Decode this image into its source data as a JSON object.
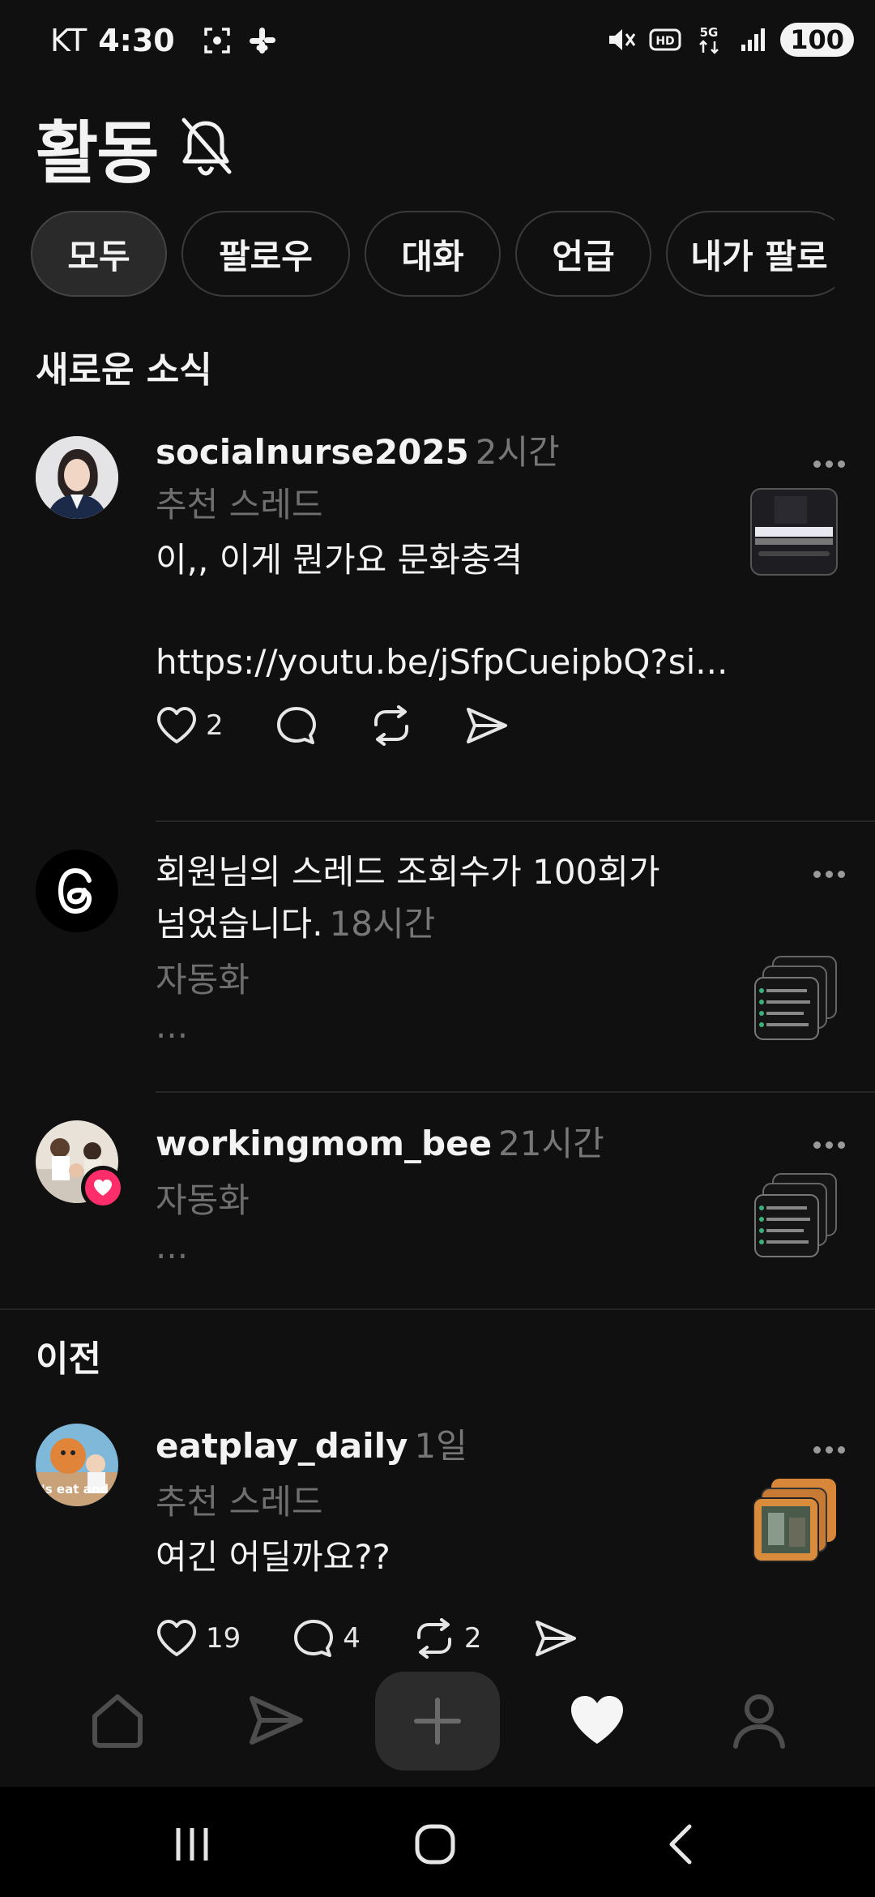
{
  "status_bar": {
    "carrier": "KT",
    "time": "4:30",
    "battery": "100",
    "icons": [
      "screenshot-icon",
      "slack-icon",
      "mute-icon",
      "hd-icon",
      "5g-icon",
      "signal-icon"
    ]
  },
  "header": {
    "title": "활동",
    "bell_icon": "bell-off-icon"
  },
  "filters": {
    "chips": [
      "모두",
      "팔로우",
      "대화",
      "언급",
      "내가 팔로"
    ],
    "active": "모두"
  },
  "sections": {
    "new": "새로운 소식",
    "earlier": "이전"
  },
  "items": [
    {
      "username": "socialnurse2025",
      "time": "2시간",
      "subtitle": "추천 스레드",
      "text": "이,, 이게 뭔가요 문화충격",
      "link": "https://youtu.be/jSfpCueipbQ?si...",
      "likes": "2"
    },
    {
      "text_line1": "회원님의 스레드 조회수가 100회가",
      "text_line2": "넘었습니다.",
      "time": "18시간",
      "subtitle": "자동화",
      "ellipsis": "..."
    },
    {
      "username": "workingmom_bee",
      "time": "21시간",
      "subtitle": "자동화",
      "ellipsis": "..."
    },
    {
      "username": "eatplay_daily",
      "time": "1일",
      "subtitle": "추천 스레드",
      "text": "여긴 어딜까요??",
      "likes": "19",
      "comments": "4",
      "reposts": "2",
      "avatar_text": "t's eat and pl"
    }
  ],
  "colors": {
    "background": "#101010",
    "text": "#f3f3f3",
    "muted": "#777777",
    "heart_badge": "#ff2d6a"
  }
}
